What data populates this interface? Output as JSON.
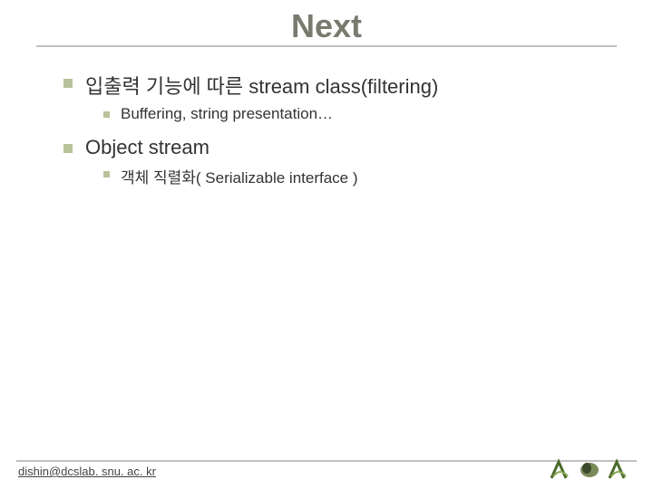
{
  "title": "Next",
  "bullets": [
    {
      "text": "입출력 기능에 따른 stream class(filtering)",
      "sub": [
        {
          "text": "Buffering, string presentation…"
        }
      ]
    },
    {
      "text": "Object stream",
      "sub": [
        {
          "text": "객체 직렬화( Serializable interface )"
        }
      ]
    }
  ],
  "footer": "dishin@dcslab. snu. ac. kr"
}
